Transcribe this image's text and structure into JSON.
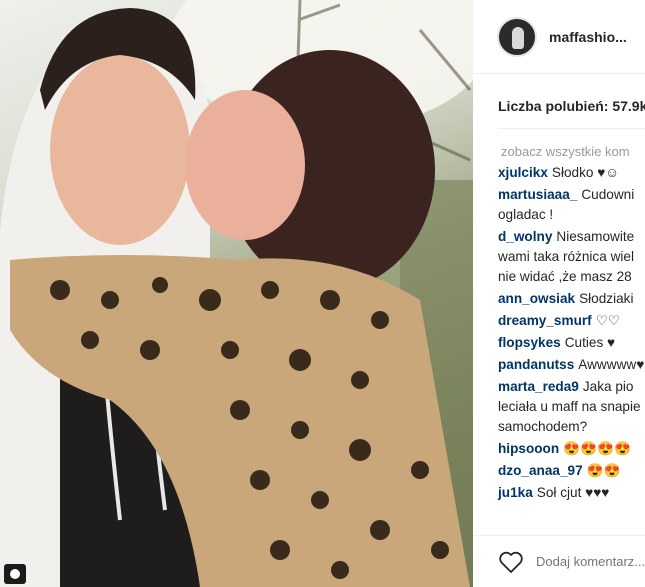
{
  "post": {
    "username": "maffashio...",
    "likes_text": "Liczba polubień: 57.9k",
    "see_all_comments": "zobacz wszystkie kom",
    "comments": [
      {
        "user": "xjulcikx",
        "text": "Słodko ♥☺"
      },
      {
        "user": "martusiaaa_",
        "text": "Cudowni\nogladac !"
      },
      {
        "user": "d_wolny",
        "text": "Niesamowite\nwami taka różnica wiel\nnie widać ,że masz 28"
      },
      {
        "user": "ann_owsiak",
        "text": "Słodziaki"
      },
      {
        "user": "dreamy_smurf",
        "text": "♡♡"
      },
      {
        "user": "flopsykes",
        "text": "Cuties ♥"
      },
      {
        "user": "pandanutss",
        "text": "Awwwww♥"
      },
      {
        "user": "marta_reda9",
        "text": "Jaka pio\nleciała u maff na snapie\nsamochodem?"
      },
      {
        "user": "hipsooon",
        "text": "😍😍😍😍"
      },
      {
        "user": "dzo_anaa_97",
        "text": "😍😍"
      },
      {
        "user": "ju1ka",
        "text": "Soł cjut ♥♥♥"
      }
    ],
    "comment_placeholder": "Dodaj komentarz..."
  },
  "colors": {
    "username_link": "#003569",
    "muted": "#999999",
    "border": "#efefef"
  },
  "icons": [
    "camera-icon",
    "heart-icon"
  ]
}
